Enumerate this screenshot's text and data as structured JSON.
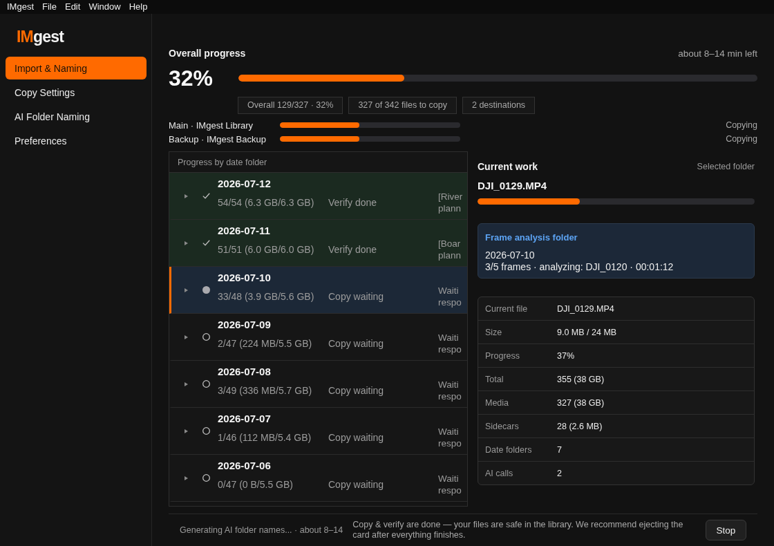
{
  "menu_bar": {
    "items": [
      "IMgest",
      "File",
      "Edit",
      "Window",
      "Help"
    ]
  },
  "sidebar": {
    "logo": {
      "accent": "IM",
      "rest": "gest"
    },
    "items": [
      {
        "label": "Import & Naming",
        "selected": true
      },
      {
        "label": "Copy Settings",
        "selected": false
      },
      {
        "label": "AI Folder Naming",
        "selected": false
      },
      {
        "label": "Preferences",
        "selected": false
      }
    ]
  },
  "overall": {
    "title": "Overall progress",
    "time_left": "about 8–14 min left",
    "percent": "32%",
    "level": 0.32,
    "chips": [
      "Overall 129/327 · 32%",
      "327 of 342 files to copy",
      "2 destinations"
    ]
  },
  "destinations": [
    {
      "name": "Main · IMgest Library",
      "level": 0.44,
      "status": "Copying"
    },
    {
      "name": "Backup · IMgest Backup",
      "level": 0.44,
      "status": "Copying"
    }
  ],
  "folders": {
    "title": "Progress by date folder",
    "rows": [
      {
        "date": "2026-07-12",
        "kind": "done",
        "expanded": false,
        "selected": false,
        "counts": "54/54 (6.3 GB/6.3 GB)",
        "status": "Verify done",
        "note": [
          "[River",
          "plann"
        ]
      },
      {
        "date": "2026-07-11",
        "kind": "done",
        "expanded": false,
        "selected": false,
        "counts": "51/51 (6.0 GB/6.0 GB)",
        "status": "Verify done",
        "note": [
          "[Boar",
          "plann"
        ]
      },
      {
        "date": "2026-07-10",
        "kind": "active",
        "expanded": false,
        "selected": true,
        "counts": "33/48 (3.9 GB/5.6 GB)",
        "status": "Copy waiting",
        "note": [
          "Waiti",
          "respo"
        ]
      },
      {
        "date": "2026-07-09",
        "kind": "waiting",
        "expanded": false,
        "selected": false,
        "counts": "2/47 (224 MB/5.5 GB)",
        "status": "Copy waiting",
        "note": [
          "Waiti",
          "respo"
        ]
      },
      {
        "date": "2026-07-08",
        "kind": "waiting",
        "expanded": false,
        "selected": false,
        "counts": "3/49 (336 MB/5.7 GB)",
        "status": "Copy waiting",
        "note": [
          "Waiti",
          "respo"
        ]
      },
      {
        "date": "2026-07-07",
        "kind": "waiting",
        "expanded": false,
        "selected": false,
        "counts": "1/46 (112 MB/5.4 GB)",
        "status": "Copy waiting",
        "note": [
          "Waiti",
          "respo"
        ]
      },
      {
        "date": "2026-07-06",
        "kind": "waiting",
        "expanded": false,
        "selected": false,
        "counts": "0/47 (0 B/5.5 GB)",
        "status": "Copy waiting",
        "note": [
          "Waiti",
          "respo"
        ]
      }
    ]
  },
  "current_work": {
    "title": "Current work",
    "scope": "Selected folder",
    "file": "DJI_0129.MP4",
    "level": 0.37,
    "frame_analysis": {
      "title": "Frame analysis folder",
      "lines": [
        "2026-07-10",
        "3/5 frames · analyzing: DJI_0120 · 00:01:12"
      ]
    },
    "details": [
      {
        "label": "Current file",
        "value": "DJI_0129.MP4"
      },
      {
        "label": "Size",
        "value": "9.0 MB / 24 MB"
      },
      {
        "label": "Progress",
        "value": "37%"
      },
      {
        "label": "Total",
        "value": "355 (38 GB)"
      },
      {
        "label": "Media",
        "value": "327 (38 GB)"
      },
      {
        "label": "Sidecars",
        "value": "28 (2.6 MB)"
      },
      {
        "label": "Date folders",
        "value": "7"
      },
      {
        "label": "AI calls",
        "value": "2"
      }
    ]
  },
  "footer": {
    "status": "Generating AI folder names... · about 8–14",
    "message": "Copy & verify are done — your files are safe in the library. We recommend ejecting the card after everything finishes.",
    "button": "Stop"
  }
}
